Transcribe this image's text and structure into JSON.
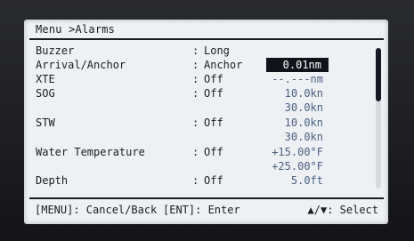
{
  "title": "Menu >Alarms",
  "rows": [
    {
      "label": "Buzzer",
      "colon": ":",
      "value": "Long",
      "sub": ""
    },
    {
      "label": "Arrival/Anchor",
      "colon": ":",
      "value": "Anchor",
      "sub": "0.01nm",
      "selected": true
    },
    {
      "label": "XTE",
      "colon": ":",
      "value": "Off",
      "sub": "--.---nm"
    },
    {
      "label": "SOG",
      "colon": ":",
      "value": "Off",
      "sub": "10.0kn"
    },
    {
      "label": "",
      "colon": "",
      "value": "",
      "sub": "30.0kn"
    },
    {
      "label": "STW",
      "colon": ":",
      "value": "Off",
      "sub": "10.0kn"
    },
    {
      "label": "",
      "colon": "",
      "value": "",
      "sub": "30.0kn"
    },
    {
      "label": "Water Temperature",
      "colon": ":",
      "value": "Off",
      "sub": "+15.00°F"
    },
    {
      "label": "",
      "colon": "",
      "value": "",
      "sub": "+25.00°F"
    },
    {
      "label": "Depth",
      "colon": ":",
      "value": "Off",
      "sub": "5.0ft"
    }
  ],
  "footer": {
    "cancel": "[MENU]: Cancel/Back",
    "enter": "[ENT]: Enter",
    "select": "▲/▼: Select"
  }
}
